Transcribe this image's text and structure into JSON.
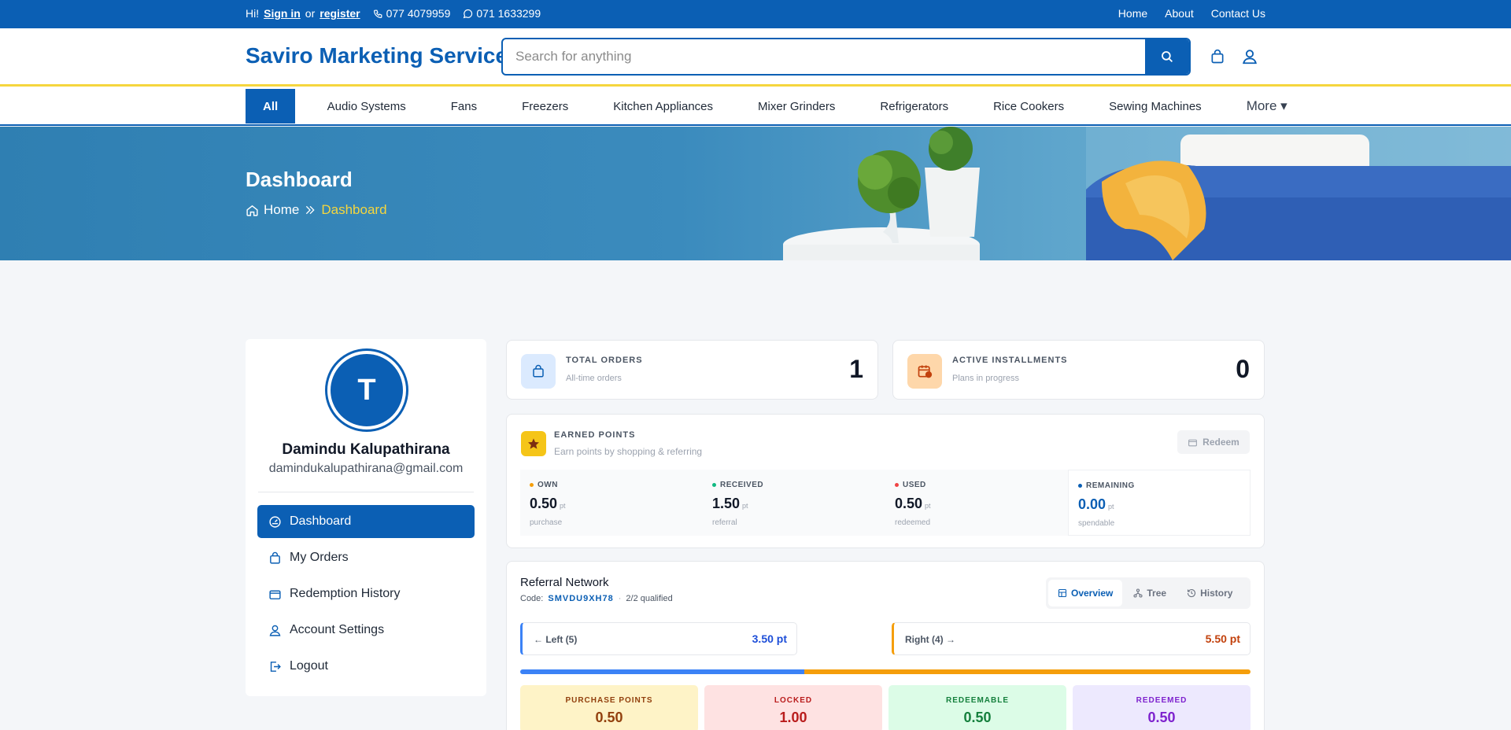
{
  "topbar": {
    "greeting": "Hi!",
    "sign_in": "Sign in",
    "or": "or",
    "register": "register",
    "phone1": "077 4079959",
    "phone2": "071 1633299",
    "links": [
      "Home",
      "About",
      "Contact Us"
    ]
  },
  "header": {
    "brand": "Saviro Marketing Service",
    "search_placeholder": "Search for anything"
  },
  "categories": {
    "all": "All",
    "items": [
      "Audio Systems",
      "Fans",
      "Freezers",
      "Kitchen Appliances",
      "Mixer Grinders",
      "Refrigerators",
      "Rice Cookers",
      "Sewing Machines"
    ],
    "more": "More ▾"
  },
  "hero": {
    "title": "Dashboard",
    "crumb_home": "Home",
    "crumb_current": "Dashboard"
  },
  "user": {
    "initial": "T",
    "name": "Damindu Kalupathirana",
    "email": "damindukalupathirana@gmail.com"
  },
  "menu": [
    "Dashboard",
    "My Orders",
    "Redemption History",
    "Account Settings",
    "Logout"
  ],
  "stats": {
    "orders": {
      "label": "TOTAL ORDERS",
      "sub": "All-time orders",
      "value": "1"
    },
    "installments": {
      "label": "ACTIVE INSTALLMENTS",
      "sub": "Plans in progress",
      "value": "0"
    }
  },
  "points": {
    "title": "EARNED POINTS",
    "sub": "Earn points by shopping & referring",
    "redeem": "Redeem",
    "unit": "pt",
    "boxes": [
      {
        "label": "OWN",
        "value": "0.50",
        "sub": "purchase",
        "color": "#f59e0b"
      },
      {
        "label": "RECEIVED",
        "value": "1.50",
        "sub": "referral",
        "color": "#10b981"
      },
      {
        "label": "USED",
        "value": "0.50",
        "sub": "redeemed",
        "color": "#ef4444"
      },
      {
        "label": "REMAINING",
        "value": "0.00",
        "sub": "spendable",
        "color": "#0b5fb4"
      }
    ]
  },
  "referral": {
    "title": "Referral Network",
    "code_label": "Code:",
    "code": "SMVDU9XH78",
    "sep": "·",
    "qualified": "2/2 qualified",
    "tabs": [
      "Overview",
      "Tree",
      "History"
    ],
    "left": {
      "label": "← Left (5)",
      "value": "3.50 pt",
      "color": "#1d4ed8"
    },
    "right": {
      "label": "Right (4) →",
      "value": "5.50 pt",
      "color": "#c2410c"
    },
    "bar_left_fraction": 0.389,
    "tiles": [
      {
        "label": "PURCHASE POINTS",
        "value": "0.50",
        "bg": "#fef3c7",
        "fg": "#92400e"
      },
      {
        "label": "LOCKED",
        "value": "1.00",
        "bg": "#fee2e2",
        "fg": "#b91c1c"
      },
      {
        "label": "REDEEMABLE",
        "value": "0.50",
        "bg": "#dcfce7",
        "fg": "#15803d"
      },
      {
        "label": "REDEEMED",
        "value": "0.50",
        "bg": "#ede9fe",
        "fg": "#7e22ce"
      }
    ]
  }
}
